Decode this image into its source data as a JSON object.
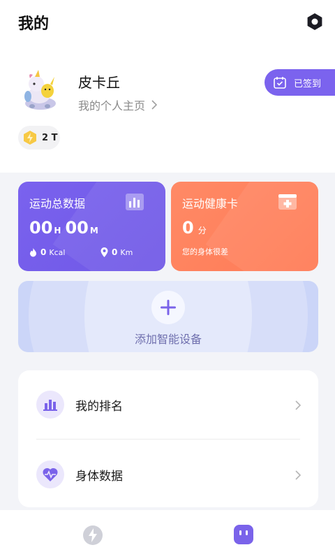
{
  "header": {
    "title": "我的"
  },
  "profile": {
    "name": "皮卡丘",
    "homepage_link": "我的个人主页",
    "checkin_label": "已签到",
    "coin_value": "2 T"
  },
  "cards": {
    "sport": {
      "title": "运动总数据",
      "hours": "00",
      "hours_unit": "H",
      "minutes": "00",
      "minutes_unit": "M",
      "calories": "0",
      "calories_unit": "Kcal",
      "distance": "0",
      "distance_unit": "Km"
    },
    "health": {
      "title": "运动健康卡",
      "score": "0",
      "score_unit": "分",
      "description": "您的身体很差"
    }
  },
  "device": {
    "label": "添加智能设备"
  },
  "menu": {
    "items": [
      {
        "label": "我的排名",
        "icon": "bar-chart-icon"
      },
      {
        "label": "身体数据",
        "icon": "heart-pulse-icon"
      }
    ]
  },
  "tabbar": {
    "tabs": [
      {
        "icon": "lightning-icon",
        "active": false
      },
      {
        "icon": "robot-face-icon",
        "active": true
      }
    ]
  },
  "colors": {
    "accent": "#7b63ee",
    "health": "#ff7a55",
    "device_bg": "#cbd5f8"
  }
}
